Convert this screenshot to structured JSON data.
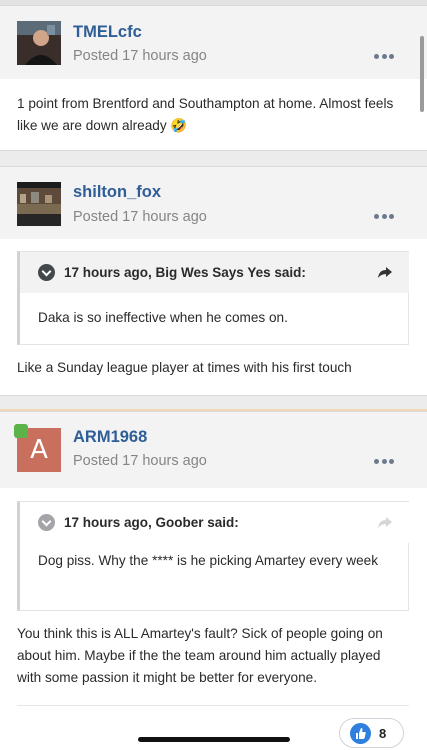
{
  "posts": [
    {
      "author": "TMELcfc",
      "posted": "Posted 17 hours ago",
      "avatar_icon": "profile-photo",
      "body": "1 point from Brentford and Southampton at home. Almost feels like we are down already 🤣"
    },
    {
      "author": "shilton_fox",
      "posted": "Posted 17 hours ago",
      "avatar_icon": "profile-photo",
      "quote": {
        "title": "17 hours ago, Big Wes Says Yes said:",
        "text": "Daka is so ineffective when he comes on."
      },
      "body": "Like a Sunday league player at times with his first touch"
    },
    {
      "author": "ARM1968",
      "posted": "Posted 17 hours ago",
      "avatar_letter": "A",
      "quote": {
        "title": "17 hours ago, Goober said:",
        "text": "Dog piss. Why the **** is he picking Amartey every week"
      },
      "body": "You think this is ALL Amartey's fault?  Sick of people going on about him. Maybe if the the team around him actually played with some passion it might be better for everyone."
    }
  ],
  "reaction": {
    "icon": "thumbs-up-icon",
    "count": "8"
  },
  "colors": {
    "author": "#2f5e97",
    "avatar_letter_bg": "#c8705d",
    "online": "#5cb34a",
    "like": "#2f7fde"
  }
}
